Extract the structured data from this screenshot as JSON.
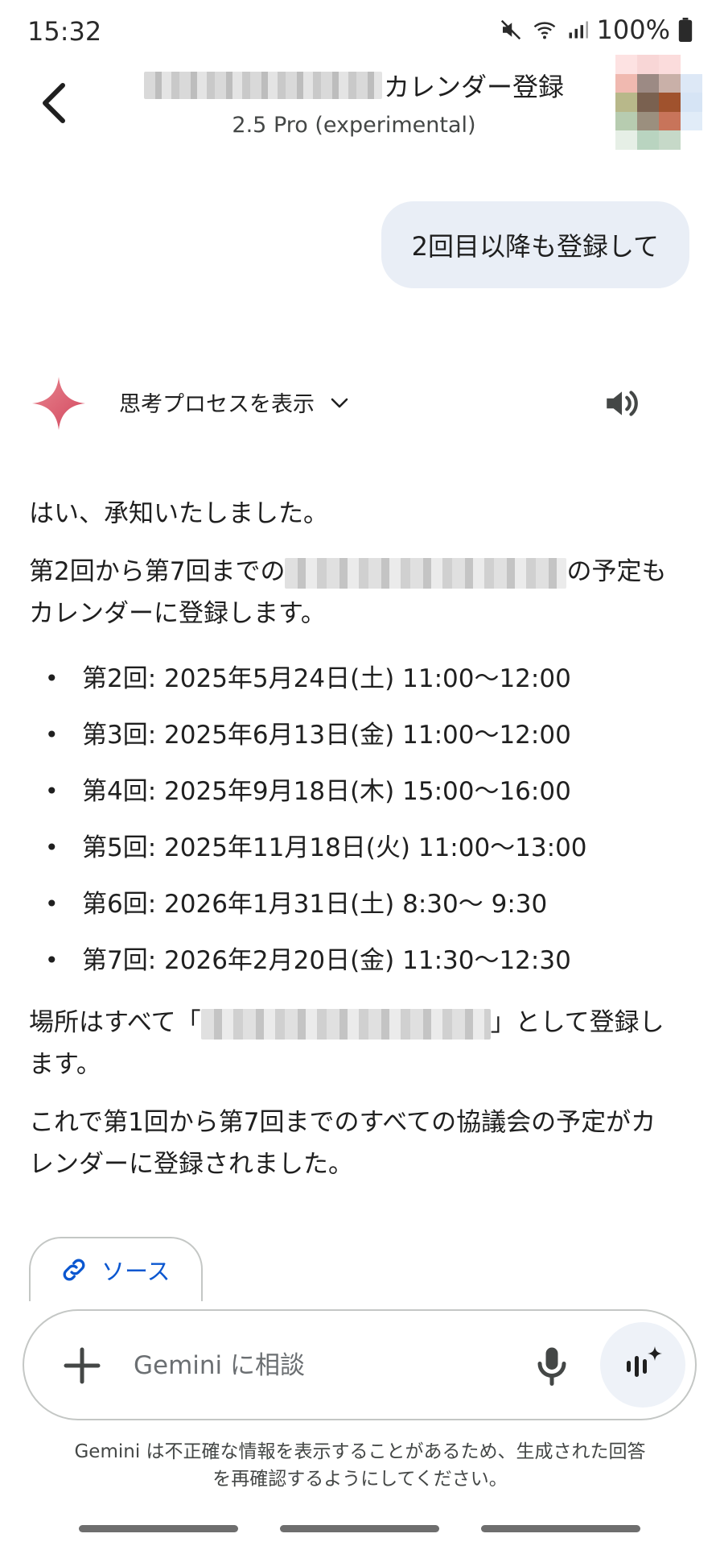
{
  "status_bar": {
    "time": "15:32",
    "battery": "100%",
    "icons": [
      "mute-icon",
      "wifi-icon",
      "signal-icon",
      "battery-icon"
    ]
  },
  "header": {
    "title_suffix": "カレンダー登録",
    "subtitle": "2.5 Pro (experimental)",
    "back_icon": "chevron-left-icon"
  },
  "conversation": {
    "user_message": "2回目以降も登録して",
    "response": {
      "thinking_label": "思考プロセスを表示",
      "intro": "はい、承知いたしました。",
      "para2_start": "第2回から第7回までの",
      "para2_mid": "の予定も",
      "para2_end": "カレンダーに登録します。",
      "events": [
        "第2回: 2025年5月24日(土) 11:00〜12:00",
        "第3回: 2025年6月13日(金) 11:00〜12:00",
        "第4回: 2025年9月18日(木) 15:00〜16:00",
        "第5回: 2025年11月18日(火) 11:00〜13:00",
        "第6回: 2026年1月31日(土) 8:30〜 9:30",
        "第7回: 2026年2月20日(金) 11:30〜12:30"
      ],
      "location_start": "場所はすべて「",
      "location_end": "」として登録し",
      "location_end2": "ます。",
      "closing_line1": "これで第1回から第7回までのすべての協議会の予定がカ",
      "closing_line2": "レンダーに登録されました。",
      "sources_label": "ソース"
    }
  },
  "composer": {
    "placeholder": "Gemini に相談"
  },
  "disclaimer_line1": "Gemini は不正確な情報を表示することがあるため、生成された回答",
  "disclaimer_line2": "を再確認するようにしてください。",
  "colors": {
    "bubble_bg": "#e9eef6",
    "link_blue": "#0b57d0",
    "spark_start": "#d9566b",
    "spark_end": "#e8868f"
  }
}
